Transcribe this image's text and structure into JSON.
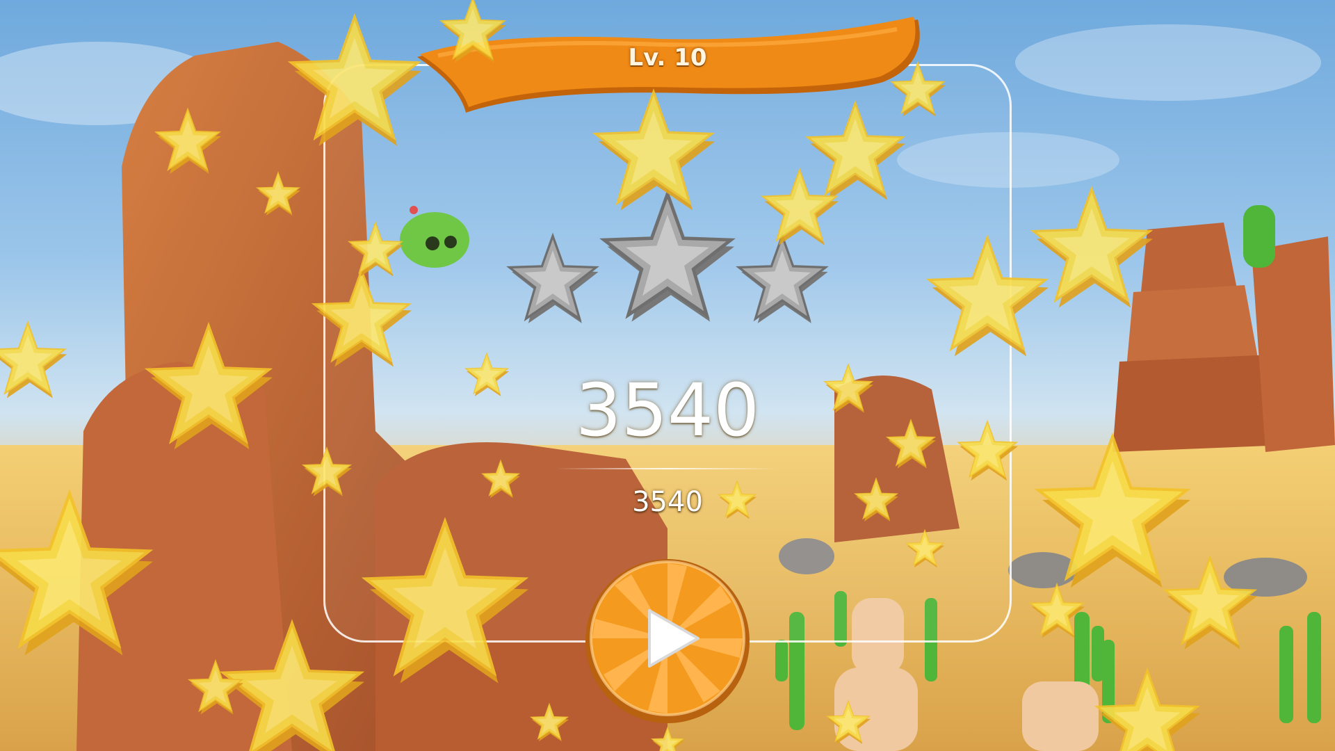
{
  "level": {
    "label": "Lv. 10"
  },
  "result": {
    "stars_earned": 0,
    "stars_total": 3,
    "score": "3540",
    "score_secondary": "3540"
  },
  "controls": {
    "play_icon": "play-icon"
  },
  "colors": {
    "banner_orange": "#f08a16",
    "banner_dark": "#c4640a",
    "star_gold": "#f7dc4a",
    "star_silver": "#9a9a9a",
    "button_orange": "#f39a1f"
  }
}
